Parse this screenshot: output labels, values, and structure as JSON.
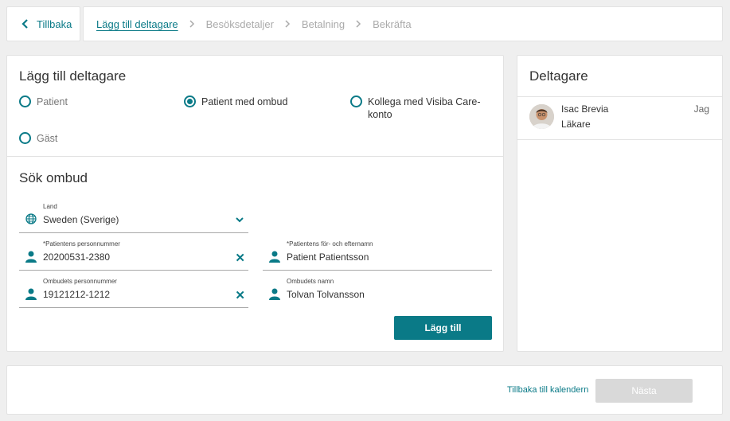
{
  "nav": {
    "back_label": "Tillbaka",
    "steps": [
      {
        "label": "Lägg till deltagare"
      },
      {
        "label": "Besöksdetaljer"
      },
      {
        "label": "Betalning"
      },
      {
        "label": "Bekräfta"
      }
    ],
    "active_step": 0
  },
  "add_participant": {
    "title": "Lägg till deltagare",
    "options": [
      {
        "label": "Patient",
        "selected": false
      },
      {
        "label": "Patient med ombud",
        "selected": true
      },
      {
        "label": "Kollega med Visiba Care-konto",
        "line1": "Kollega med Visiba Care-",
        "line2": "konto",
        "selected": false
      },
      {
        "label": "Gäst",
        "selected": false
      }
    ]
  },
  "search": {
    "title": "Sök ombud",
    "country": {
      "label": "Land",
      "value": "Sweden (Sverige)"
    },
    "patient_pnr": {
      "label": "*Patientens personnummer",
      "value": "20200531-2380"
    },
    "patient_name": {
      "label": "*Patientens för- och efternamn",
      "value": "Patient Patientsson"
    },
    "proxy_pnr": {
      "label": "Ombudets personnummer",
      "value": "19121212-1212"
    },
    "proxy_name": {
      "label": "Ombudets namn",
      "value": "Tolvan Tolvansson"
    },
    "add_button": "Lägg till"
  },
  "participants": {
    "title": "Deltagare",
    "items": [
      {
        "name": "Isac Brevia",
        "role": "Läkare",
        "tag": "Jag"
      }
    ]
  },
  "footer": {
    "back_to_calendar": "Tillbaka till kalendern",
    "next": "Nästa"
  },
  "colors": {
    "accent": "#0a7a87",
    "disabled": "#d9d9d9"
  }
}
